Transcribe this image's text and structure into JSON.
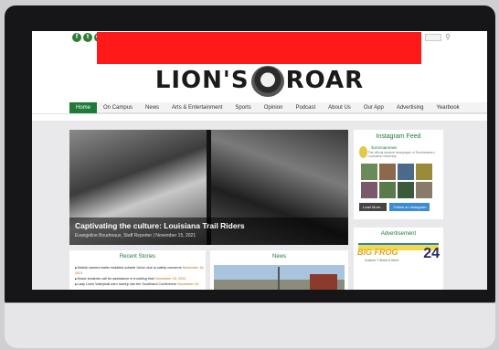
{
  "site": {
    "logo_text_left": "LION'S",
    "logo_text_right": "ROAR",
    "social_icons": [
      "facebook-icon",
      "twitter-icon",
      "instagram-icon",
      "youtube-icon"
    ]
  },
  "nav": {
    "items": [
      "Home",
      "On Campus",
      "News",
      "Arts & Entertainment",
      "Sports",
      "Opinion",
      "Podcast",
      "About Us",
      "Our App",
      "Advertising",
      "Yearbook"
    ],
    "active": "Home"
  },
  "hero": {
    "title": "Captivating the culture: Louisiana Trail Riders",
    "meta": "Evangeline Boudreaux, Staff Reporter | November 15, 2021"
  },
  "instagram": {
    "title": "Instagram Feed",
    "account": "lionsroarnews",
    "description": "The official student newspaper of Southeastern Louisiana University",
    "load_more": "Load More...",
    "follow": "Follow on Instagram"
  },
  "advertisement": {
    "title": "Advertisement",
    "brand": "BIG FROG",
    "subtitle": "Custom T-Shirts & More",
    "number": "24"
  },
  "recent_stories": {
    "title": "Recent Stories",
    "items": [
      {
        "text": "Mobile camera trailer installed outside Union due to safety concerns",
        "date": "November 15, 2021"
      },
      {
        "text": "Music students call for assistance in troubling time",
        "date": "November 15, 2021"
      },
      {
        "text": "Lady Lions Volleyball earn sweep into the Southland Conference",
        "date": "November 15"
      }
    ]
  },
  "news": {
    "title": "News"
  },
  "colors": {
    "brand_green": "#1f7a3a",
    "redaction": "#ff1a1a"
  }
}
